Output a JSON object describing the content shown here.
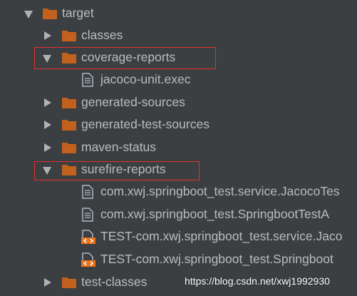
{
  "tree": {
    "items": [
      {
        "label": "target",
        "type": "folder",
        "expanded": true
      },
      {
        "label": "classes",
        "type": "folder",
        "expanded": false
      },
      {
        "label": "coverage-reports",
        "type": "folder",
        "expanded": true
      },
      {
        "label": "jacoco-unit.exec",
        "type": "file"
      },
      {
        "label": "generated-sources",
        "type": "folder",
        "expanded": false
      },
      {
        "label": "generated-test-sources",
        "type": "folder",
        "expanded": false
      },
      {
        "label": "maven-status",
        "type": "folder",
        "expanded": false
      },
      {
        "label": "surefire-reports",
        "type": "folder",
        "expanded": true
      },
      {
        "label": "com.xwj.springboot_test.service.JacocoTes",
        "type": "file"
      },
      {
        "label": "com.xwj.springboot_test.SpringbootTestA",
        "type": "file"
      },
      {
        "label": "TEST-com.xwj.springboot_test.service.Jaco",
        "type": "xml-file"
      },
      {
        "label": "TEST-com.xwj.springboot_test.Springboot",
        "type": "xml-file"
      },
      {
        "label": "test-classes",
        "type": "folder",
        "expanded": false
      }
    ]
  },
  "watermark": "https://blog.csdn.net/xwj1992930",
  "colors": {
    "background": "#3c3f41",
    "text": "#bbbbbb",
    "folder": "#c2611d",
    "file": "#a9b7c6",
    "highlight_border": "#e0312d"
  }
}
